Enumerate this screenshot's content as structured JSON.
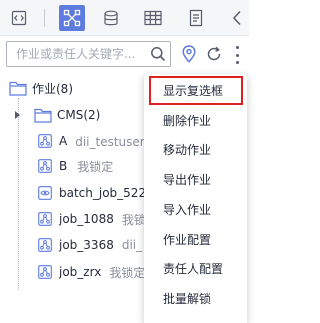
{
  "toolbar": {
    "buttons": [
      {
        "icon": "code-icon",
        "active": false
      },
      {
        "icon": "workflow-icon",
        "active": true
      },
      {
        "icon": "database-icon",
        "active": false
      },
      {
        "icon": "table-icon",
        "active": false
      },
      {
        "icon": "document-icon",
        "active": false
      },
      {
        "icon": "collapse-left-icon",
        "active": false
      }
    ],
    "active_color": "#5e7ce0"
  },
  "search": {
    "placeholder": "作业或责任人关键字...",
    "value": ""
  },
  "tree": {
    "root": {
      "label": "作业(8)",
      "icon": "folder-icon"
    },
    "items": [
      {
        "label": "CMS(2)",
        "suffix": "",
        "icon": "folder-icon",
        "expandable": true
      },
      {
        "label": "A",
        "suffix": "dii_testuser锁",
        "icon": "job-icon"
      },
      {
        "label": "B",
        "suffix": "我锁定",
        "icon": "job-icon"
      },
      {
        "label": "batch_job_522",
        "suffix": "",
        "icon": "batch-job-icon"
      },
      {
        "label": "job_1088",
        "suffix": "我锁",
        "icon": "job-icon"
      },
      {
        "label": "job_3368",
        "suffix": "dii_",
        "icon": "job-icon"
      },
      {
        "label": "job_zrx",
        "suffix": "我锁定",
        "icon": "job-icon"
      }
    ]
  },
  "menu": {
    "items": [
      {
        "label": "显示复选框",
        "highlighted": true
      },
      {
        "label": "删除作业"
      },
      {
        "label": "移动作业"
      },
      {
        "label": "导出作业"
      },
      {
        "label": "导入作业"
      },
      {
        "label": "作业配置"
      },
      {
        "label": "责任人配置"
      },
      {
        "label": "批量解锁"
      }
    ],
    "highlight_color": "#e02020"
  }
}
